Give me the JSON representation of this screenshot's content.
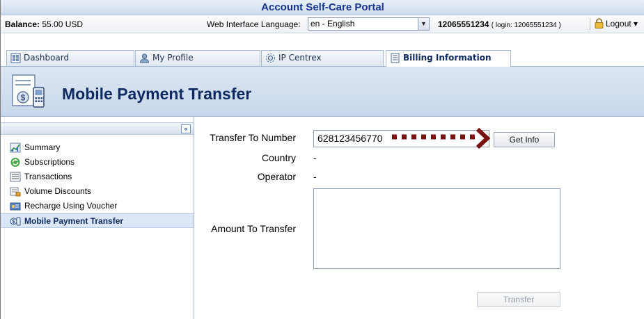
{
  "window": {
    "title": "Account Self-Care Portal"
  },
  "infobar": {
    "balance_label": "Balance:",
    "balance_value": "55.00 USD",
    "language_label": "Web Interface Language:",
    "language_selected": "en - English",
    "account_number": "12065551234",
    "login_text": "( login: 12065551234 )",
    "logout_label": "Logout"
  },
  "tabs": [
    {
      "label": "Dashboard",
      "icon": "dashboard-icon"
    },
    {
      "label": "My Profile",
      "icon": "user-icon"
    },
    {
      "label": "IP Centrex",
      "icon": "network-icon"
    },
    {
      "label": "Billing Information",
      "icon": "document-icon",
      "active": true
    }
  ],
  "page": {
    "title": "Mobile Payment Transfer",
    "icon": "payment-phone-icon"
  },
  "sidebar": {
    "collapse_label": "«",
    "items": [
      {
        "label": "Summary",
        "icon": "chart-icon"
      },
      {
        "label": "Subscriptions",
        "icon": "refresh-icon"
      },
      {
        "label": "Transactions",
        "icon": "list-icon"
      },
      {
        "label": "Volume Discounts",
        "icon": "discount-icon"
      },
      {
        "label": "Recharge Using Voucher",
        "icon": "voucher-icon"
      },
      {
        "label": "Mobile Payment Transfer",
        "icon": "payment-phone-icon",
        "active": true
      }
    ]
  },
  "form": {
    "transfer_to_label": "Transfer To Number",
    "transfer_to_value": "628123456770",
    "get_info_label": "Get Info",
    "country_label": "Country",
    "country_value": "-",
    "operator_label": "Operator",
    "operator_value": "-",
    "amount_label": "Amount To Transfer",
    "transfer_label": "Transfer"
  },
  "colors": {
    "accent": "#0f2a60",
    "annotation": "#7a1010"
  }
}
